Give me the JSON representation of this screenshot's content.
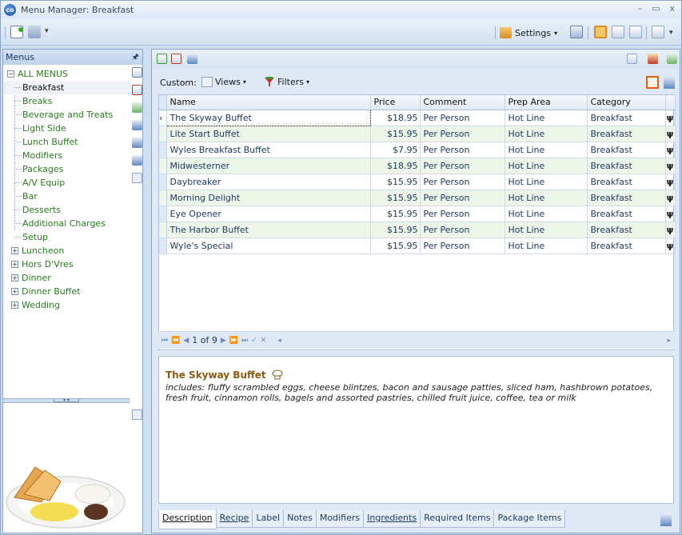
{
  "window": {
    "title": "Menu Manager: Breakfast",
    "controls": [
      "–",
      "▭",
      "x"
    ]
  },
  "toolbar": {
    "settings_label": "Settings"
  },
  "menus_panel": {
    "header": "Menus",
    "root": "ALL MENUS",
    "children": [
      "Breakfast",
      "Breaks",
      "Beverage and Treats",
      "Light Side",
      "Lunch Buffet",
      "Modifiers",
      "Packages",
      "A/V Equip",
      "Bar",
      "Desserts",
      "Additional Charges",
      "Setup"
    ],
    "selected_child": "Breakfast",
    "collapsed_groups": [
      "Luncheon",
      "Hors D'Vres",
      "Dinner",
      "Dinner Buffet",
      "Wedding"
    ]
  },
  "custom_bar": {
    "label": "Custom:",
    "views_label": "Views",
    "filters_label": "Filters"
  },
  "grid": {
    "columns": [
      "Name",
      "Price",
      "Comment",
      "Prep Area",
      "Category"
    ],
    "rows": [
      {
        "name": "The Skyway Buffet",
        "price": "$18.95",
        "comment": "Per Person",
        "prep": "Hot Line",
        "category": "Breakfast"
      },
      {
        "name": "Lite Start Buffet",
        "price": "$15.95",
        "comment": "Per Person",
        "prep": "Hot Line",
        "category": "Breakfast"
      },
      {
        "name": "Wyles Breakfast Buffet",
        "price": "$7.95",
        "comment": "Per Person",
        "prep": "Hot Line",
        "category": "Breakfast"
      },
      {
        "name": "Midwesterner",
        "price": "$18.95",
        "comment": "Per Person",
        "prep": "Hot Line",
        "category": "Breakfast"
      },
      {
        "name": "Daybreaker",
        "price": "$15.95",
        "comment": "Per Person",
        "prep": "Hot Line",
        "category": "Breakfast"
      },
      {
        "name": "Morning Delight",
        "price": "$15.95",
        "comment": "Per Person",
        "prep": "Hot Line",
        "category": "Breakfast"
      },
      {
        "name": "Eye Opener",
        "price": "$15.95",
        "comment": "Per Person",
        "prep": "Hot Line",
        "category": "Breakfast"
      },
      {
        "name": "The Harbor Buffet",
        "price": "$15.95",
        "comment": "Per Person",
        "prep": "Hot Line",
        "category": "Breakfast"
      },
      {
        "name": "Wyle's Special",
        "price": "$15.95",
        "comment": "Per Person",
        "prep": "Hot Line",
        "category": "Breakfast"
      }
    ],
    "row_marker": "🍴"
  },
  "navigator": {
    "position_text": "1 of 9"
  },
  "description": {
    "title": "The Skyway Buffet",
    "text": "includes: fluffy scrambled eggs, cheese blintzes, bacon and sausage patties, sliced ham, hashbrown potatoes, fresh fruit, cinnamon rolls, bagels and assorted pastries, chilled fruit juice, coffee, tea or milk"
  },
  "tabs": [
    "Description",
    "Recipe",
    "Label",
    "Notes",
    "Modifiers",
    "Ingredients",
    "Required Items",
    "Package Items"
  ],
  "active_tab": "Description",
  "colors": {
    "tree_text": "#2a7b1f",
    "alt_row": "#eef6e9",
    "title_brown": "#8a5a12",
    "accent_orange": "#e25c15"
  }
}
